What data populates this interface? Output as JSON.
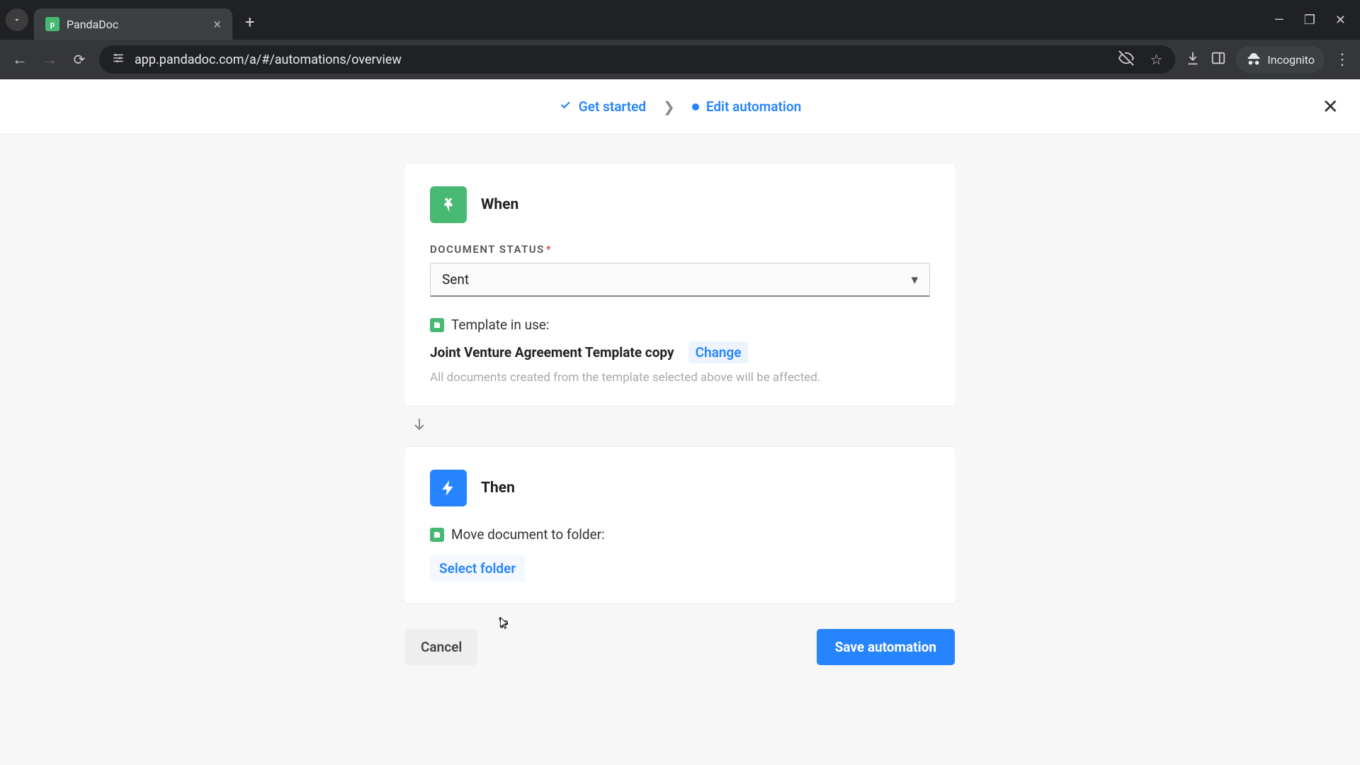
{
  "browser": {
    "tab_title": "PandaDoc",
    "url": "app.pandadoc.com/a/#/automations/overview",
    "incognito_label": "Incognito"
  },
  "header": {
    "step1": "Get started",
    "step2": "Edit automation"
  },
  "when_card": {
    "title": "When",
    "field_label": "DOCUMENT STATUS",
    "status_value": "Sent",
    "template_label": "Template in use:",
    "template_name": "Joint Venture Agreement Template copy",
    "change_label": "Change",
    "helper": "All documents created from the template selected above will be affected."
  },
  "then_card": {
    "title": "Then",
    "move_label": "Move document to folder:",
    "select_folder": "Select folder"
  },
  "footer": {
    "cancel": "Cancel",
    "save": "Save automation"
  }
}
